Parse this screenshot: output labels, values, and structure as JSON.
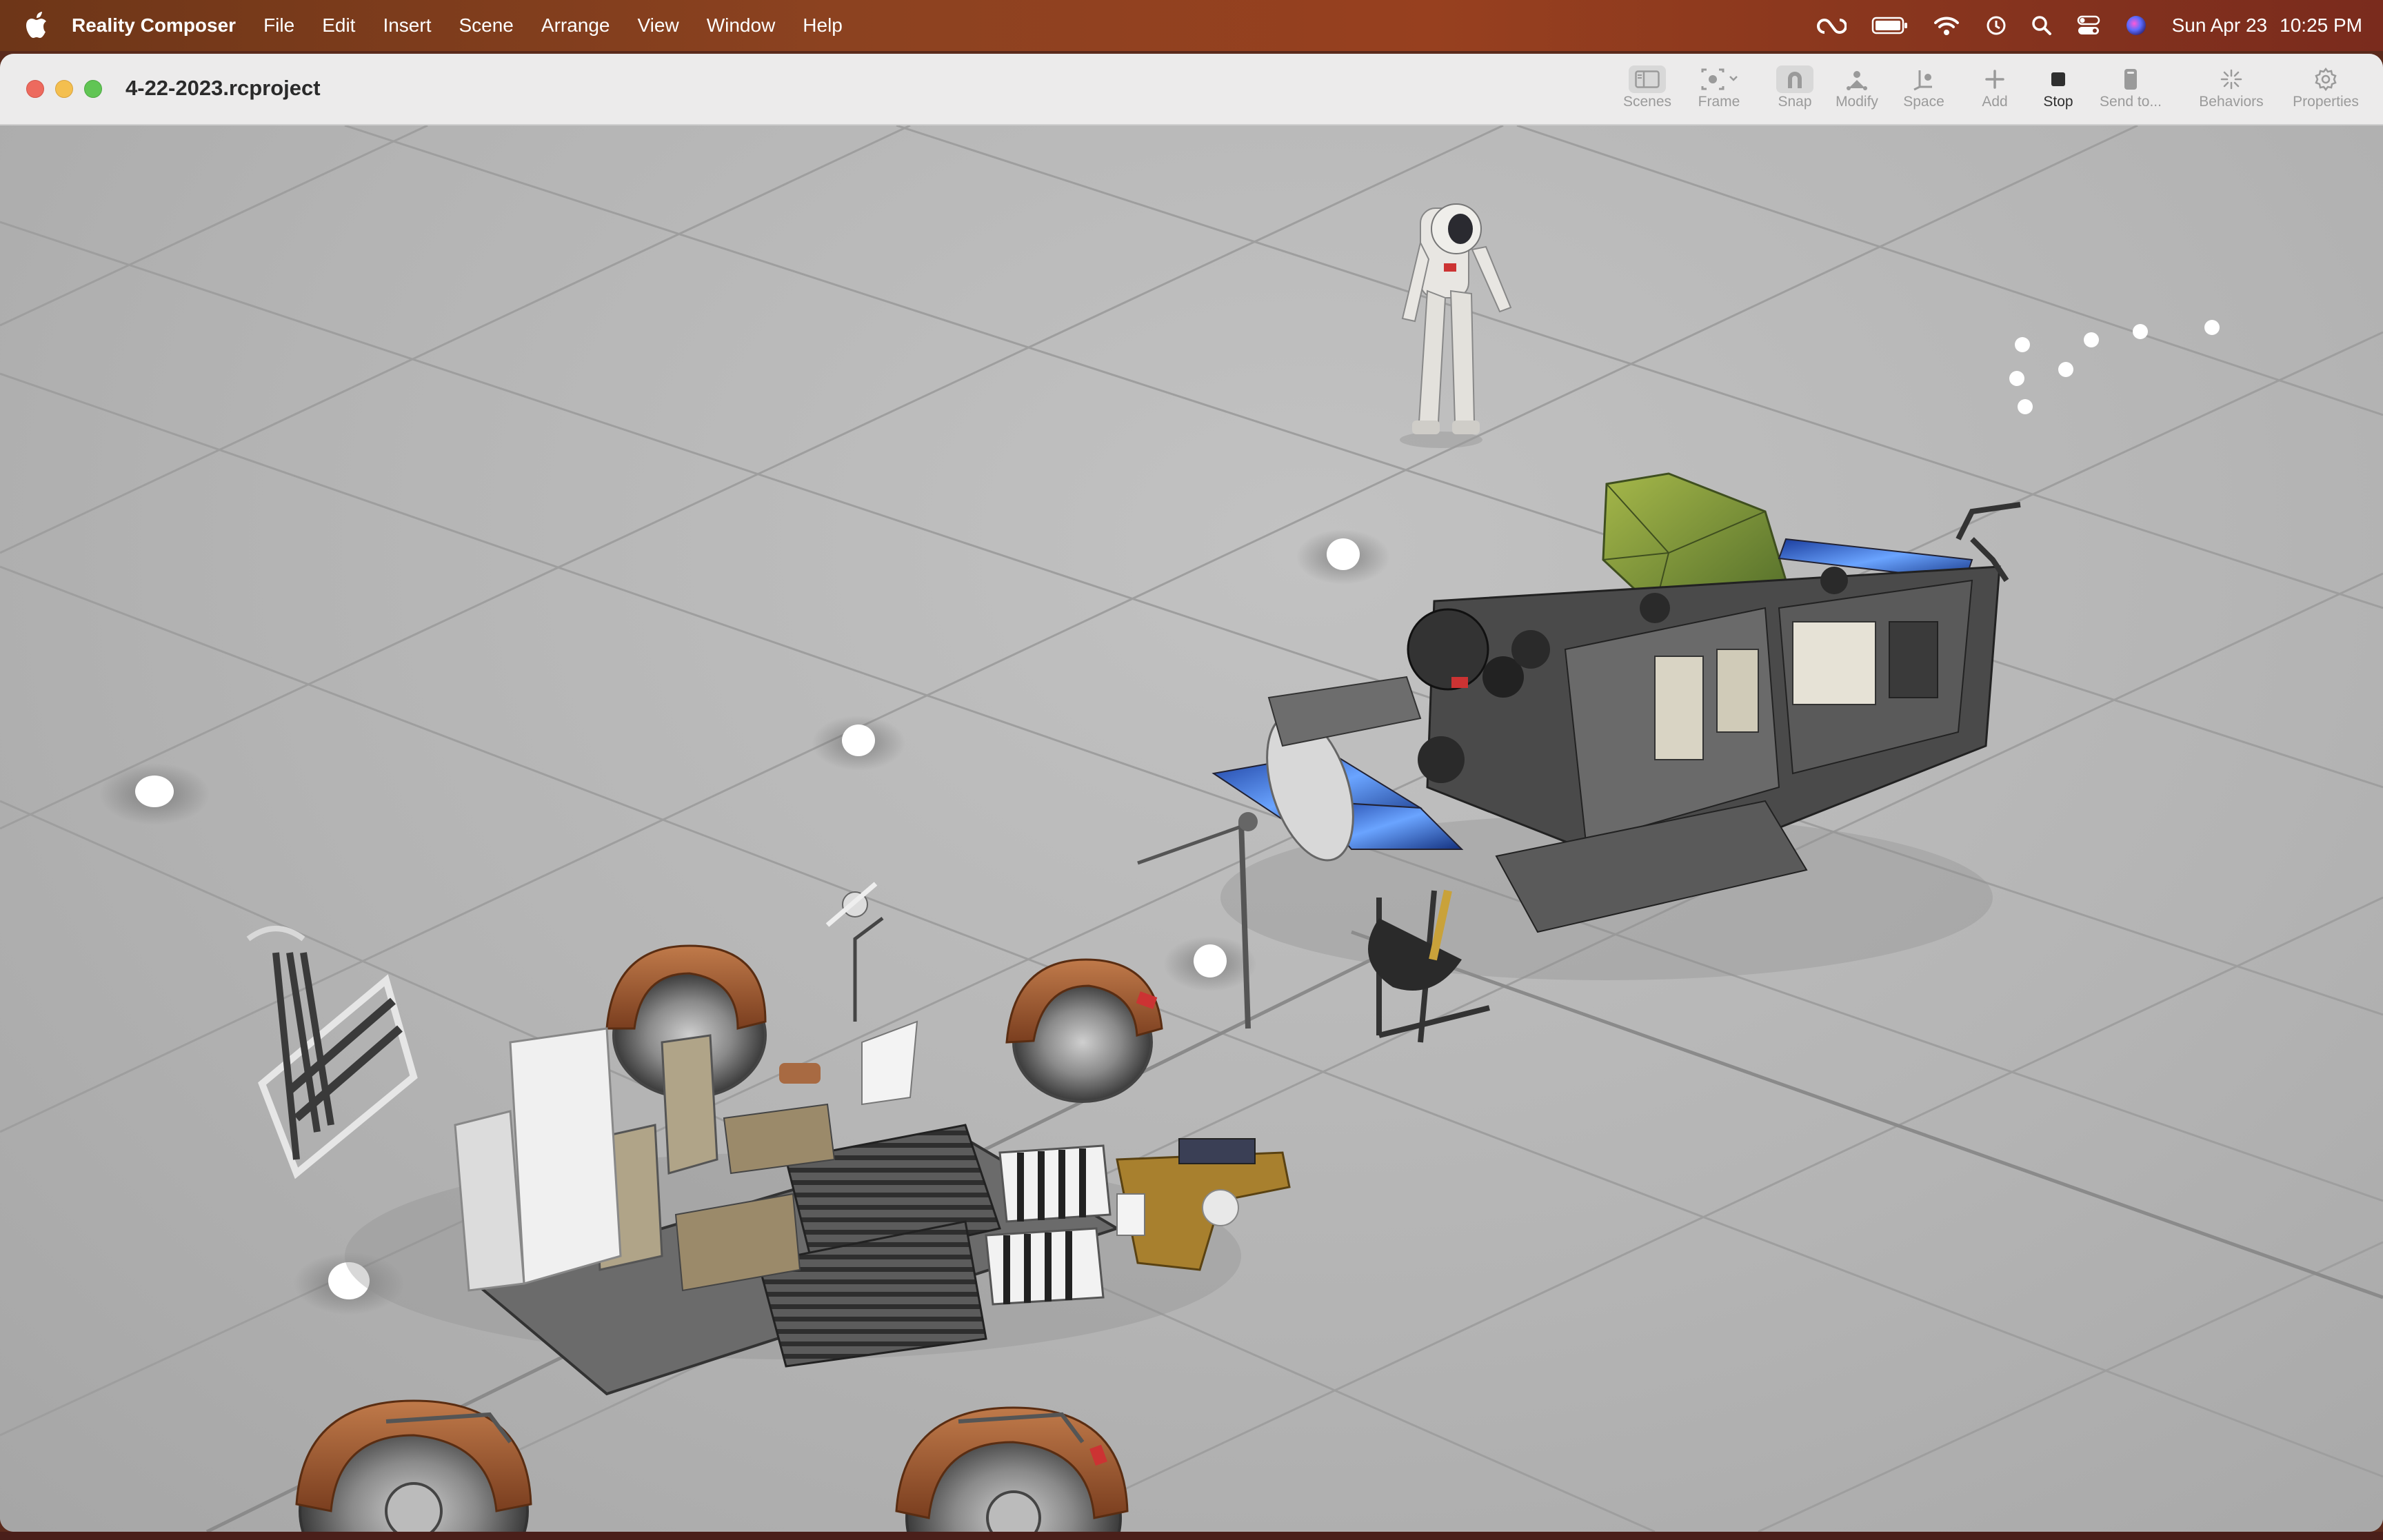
{
  "menubar": {
    "app_name": "Reality Composer",
    "items": [
      "File",
      "Edit",
      "Insert",
      "Scene",
      "Arrange",
      "View",
      "Window",
      "Help"
    ],
    "date": "Sun Apr 23",
    "time": "10:25 PM",
    "status_icons": [
      "creative-cloud-icon",
      "battery-icon",
      "wifi-icon",
      "time-machine-icon",
      "spotlight-search-icon",
      "control-center-icon",
      "siri-icon"
    ]
  },
  "window": {
    "title": "4-22-2023.rcproject",
    "toolbar": {
      "scenes": "Scenes",
      "frame": "Frame",
      "snap": "Snap",
      "modify": "Modify",
      "space": "Space",
      "add": "Add",
      "stop": "Stop",
      "send_to": "Send to...",
      "behaviors": "Behaviors",
      "properties": "Properties"
    }
  },
  "scene": {
    "objects": [
      "astronaut",
      "lunar-roving-vehicle",
      "lunar-module",
      "rover-wheel-front-left",
      "rover-wheel-front-right",
      "rover-wheel-rear-left",
      "rover-wheel-rear-right",
      "tool-rack",
      "green-crystal",
      "light-markers"
    ]
  },
  "colors": {
    "accent_orange": "#ff8c00",
    "viewport_bg": "#b4b4b4",
    "toolbar_bg": "#ecebeb"
  }
}
